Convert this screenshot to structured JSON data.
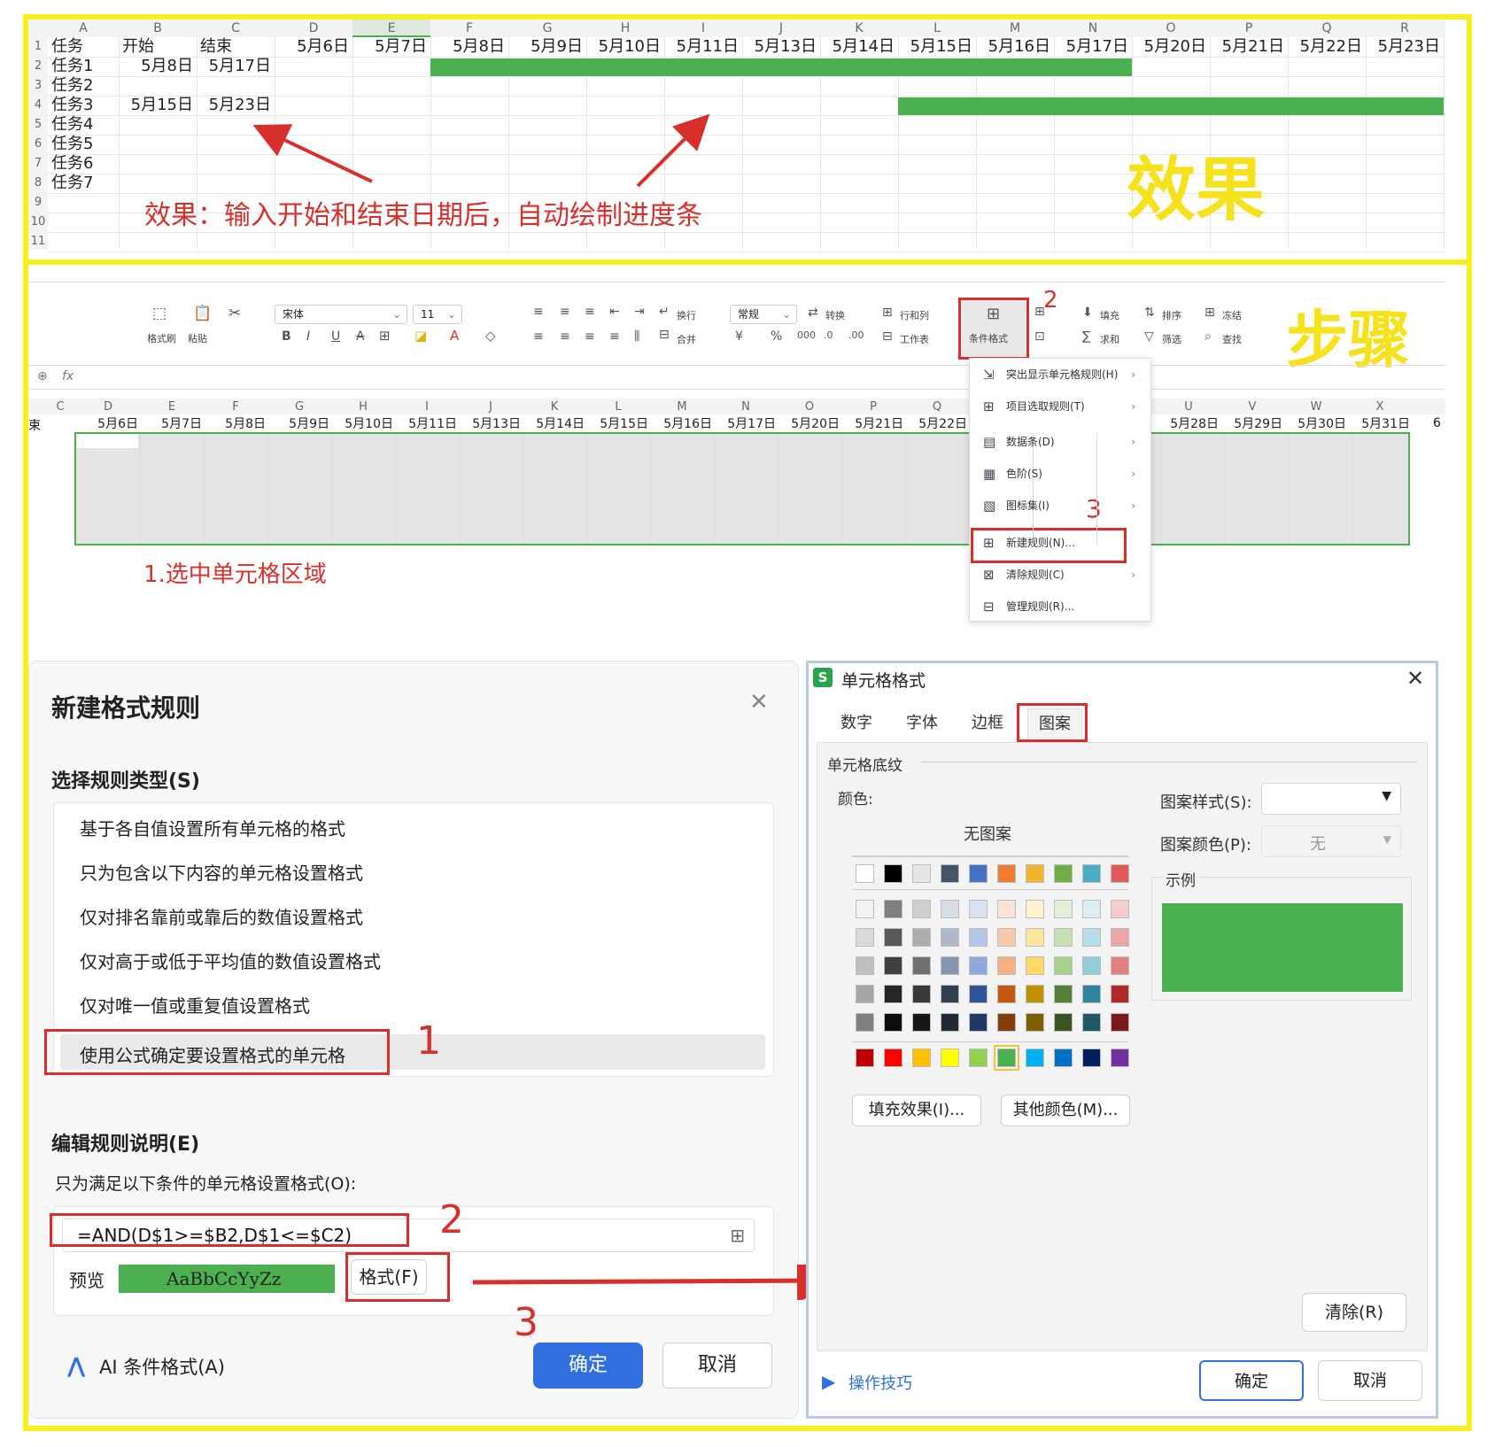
{
  "effect_sheet": {
    "columns": [
      "A",
      "B",
      "C",
      "D",
      "E",
      "F",
      "G",
      "H",
      "I",
      "J",
      "K",
      "L",
      "M",
      "N",
      "O",
      "P",
      "Q",
      "R"
    ],
    "rows": [
      "1",
      "2",
      "3",
      "4",
      "5",
      "6",
      "7",
      "8",
      "9",
      "10",
      "11"
    ],
    "header_row": [
      "任务",
      "开始",
      "结束",
      "5月6日",
      "5月7日",
      "5月8日",
      "5月9日",
      "5月10日",
      "5月11日",
      "5月13日",
      "5月14日",
      "5月15日",
      "5月16日",
      "5月17日",
      "5月20日",
      "5月21日",
      "5月22日",
      "5月23日"
    ],
    "tasks": [
      {
        "name": "任务1",
        "start": "5月8日",
        "end": "5月17日"
      },
      {
        "name": "任务2",
        "start": "",
        "end": ""
      },
      {
        "name": "任务3",
        "start": "5月15日",
        "end": "5月23日"
      },
      {
        "name": "任务4",
        "start": "",
        "end": ""
      },
      {
        "name": "任务5",
        "start": "",
        "end": ""
      },
      {
        "name": "任务6",
        "start": "",
        "end": ""
      },
      {
        "name": "任务7",
        "start": "",
        "end": ""
      }
    ],
    "bar_color": "#4caf50",
    "annotation": "效果：输入开始和结束日期后，自动绘制进度条",
    "section_title": "效果"
  },
  "steps_title": "步骤",
  "toolbar": {
    "format_painter": "格式刷",
    "paste": "粘贴",
    "font_name": "宋体",
    "font_size": "11",
    "wrap": "换行",
    "merge": "合并",
    "number_format": "常规",
    "convert": "转换",
    "row_col": "行和列",
    "worksheet": "工作表",
    "cond_format": "条件格式",
    "fill": "填充",
    "sort": "排序",
    "freeze": "冻结",
    "sum": "求和",
    "filter": "筛选",
    "find": "查找",
    "fx": "fx"
  },
  "steps_sheet": {
    "col_letters": [
      "C",
      "D",
      "E",
      "F",
      "G",
      "H",
      "I",
      "J",
      "K",
      "L",
      "M",
      "N",
      "O",
      "P",
      "Q",
      "U",
      "V",
      "W",
      "X"
    ],
    "dates_left": [
      "5月6日",
      "5月7日",
      "5月8日",
      "5月9日",
      "5月10日",
      "5月11日",
      "5月13日",
      "5月14日",
      "5月15日",
      "5月16日",
      "5月17日",
      "5月20日",
      "5月21日",
      "5月22日"
    ],
    "dates_right": [
      "5月28日",
      "5月29日",
      "5月30日",
      "5月31日"
    ],
    "first_cell": "束",
    "last_cell": "6",
    "select_note": "1.选中单元格区域"
  },
  "cond_menu": {
    "items": [
      {
        "label": "突出显示单元格规则(H)",
        "arrow": true
      },
      {
        "label": "项目选取规则(T)",
        "arrow": true
      },
      {
        "label": "数据条(D)",
        "arrow": true
      },
      {
        "label": "色阶(S)",
        "arrow": true
      },
      {
        "label": "图标集(I)",
        "arrow": true
      },
      {
        "label": "新建规则(N)...",
        "arrow": false
      },
      {
        "label": "清除规则(C)",
        "arrow": true
      },
      {
        "label": "管理规则(R)...",
        "arrow": false
      }
    ]
  },
  "markers": {
    "n1": "1",
    "n2": "2",
    "n3": "3"
  },
  "new_rule_dialog": {
    "title": "新建格式规则",
    "select_type_label": "选择规则类型(S)",
    "rule_types": [
      "基于各自值设置所有单元格的格式",
      "只为包含以下内容的单元格设置格式",
      "仅对排名靠前或靠后的数值设置格式",
      "仅对高于或低于平均值的数值设置格式",
      "仅对唯一值或重复值设置格式",
      "使用公式确定要设置格式的单元格"
    ],
    "edit_label": "编辑规则说明(E)",
    "condition_label": "只为满足以下条件的单元格设置格式(O):",
    "formula": "=AND(D$1>=$B2,D$1<=$C2)",
    "preview_label": "预览",
    "preview_text": "AaBbCcYyZz",
    "format_button": "格式(F)",
    "ai_label": "AI 条件格式(A)",
    "ok": "确定",
    "cancel": "取消"
  },
  "cell_format_dialog": {
    "title": "单元格格式",
    "tabs": [
      "数字",
      "字体",
      "边框",
      "图案"
    ],
    "shading_label": "单元格底纹",
    "color_label": "颜色:",
    "no_pattern": "无图案",
    "pattern_style_label": "图案样式(S):",
    "pattern_color_label": "图案颜色(P):",
    "pattern_color_value": "无",
    "sample_label": "示例",
    "sample_color": "#4caf50",
    "fill_effects": "填充效果(I)...",
    "more_colors": "其他颜色(M)...",
    "clear": "清除(R)",
    "tips": "操作技巧",
    "ok": "确定",
    "cancel": "取消"
  }
}
